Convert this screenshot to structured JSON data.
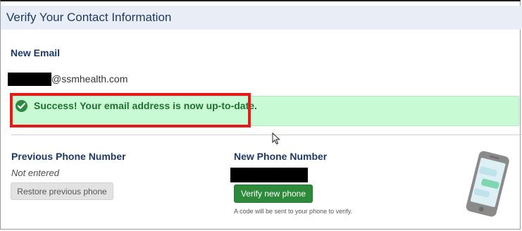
{
  "header": {
    "title": "Verify Your Contact Information"
  },
  "email": {
    "label": "New Email",
    "domain": "@ssmhealth.com"
  },
  "success": {
    "message": "Success! Your email address is now up-to-date.",
    "icon": "check-circle-icon",
    "color": "#c8fbd3"
  },
  "previous_phone": {
    "title": "Previous Phone Number",
    "value": "Not entered",
    "restore_label": "Restore previous phone"
  },
  "new_phone": {
    "title": "New Phone Number",
    "verify_label": "Verify new phone",
    "helper": "A code will be sent to your phone to verify."
  },
  "colors": {
    "header_bg": "#e9eef6",
    "accent_text": "#1e3a63",
    "success_green": "#2e8a3b",
    "highlight_red": "#e51b1b"
  }
}
